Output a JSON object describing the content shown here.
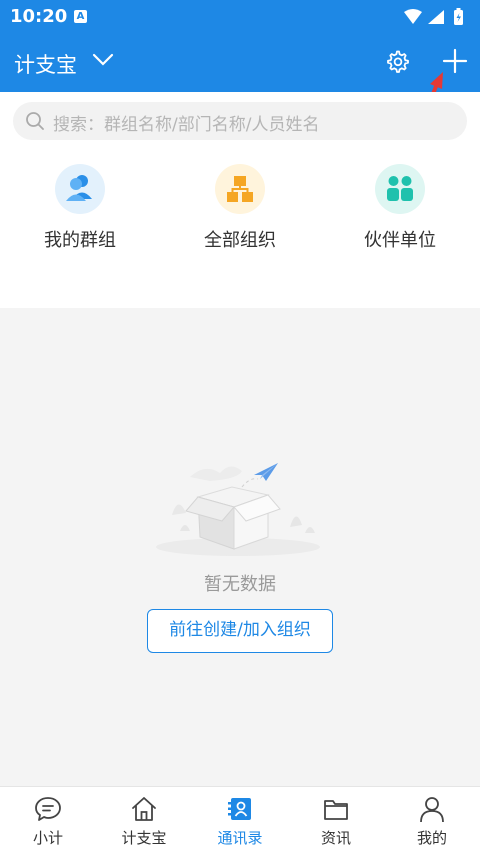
{
  "status_bar": {
    "time": "10:20",
    "notification_letter": "A"
  },
  "app_bar": {
    "title": "计支宝"
  },
  "search": {
    "placeholder": "搜索：群组名称/部门名称/人员姓名"
  },
  "quick_links": [
    {
      "label": "我的群组",
      "icon": "group-user-icon"
    },
    {
      "label": "全部组织",
      "icon": "org-chart-icon"
    },
    {
      "label": "伙伴单位",
      "icon": "partner-icon"
    }
  ],
  "empty_state": {
    "text": "暂无数据",
    "button_label": "前往创建/加入组织"
  },
  "bottom_nav": [
    {
      "label": "小计",
      "icon": "chat-icon",
      "active": false
    },
    {
      "label": "计支宝",
      "icon": "home-icon",
      "active": false
    },
    {
      "label": "通讯录",
      "icon": "contacts-icon",
      "active": true
    },
    {
      "label": "资讯",
      "icon": "folder-icon",
      "active": false
    },
    {
      "label": "我的",
      "icon": "person-icon",
      "active": false
    }
  ],
  "colors": {
    "primary": "#1E88E5",
    "annotation_arrow": "#E53935"
  }
}
